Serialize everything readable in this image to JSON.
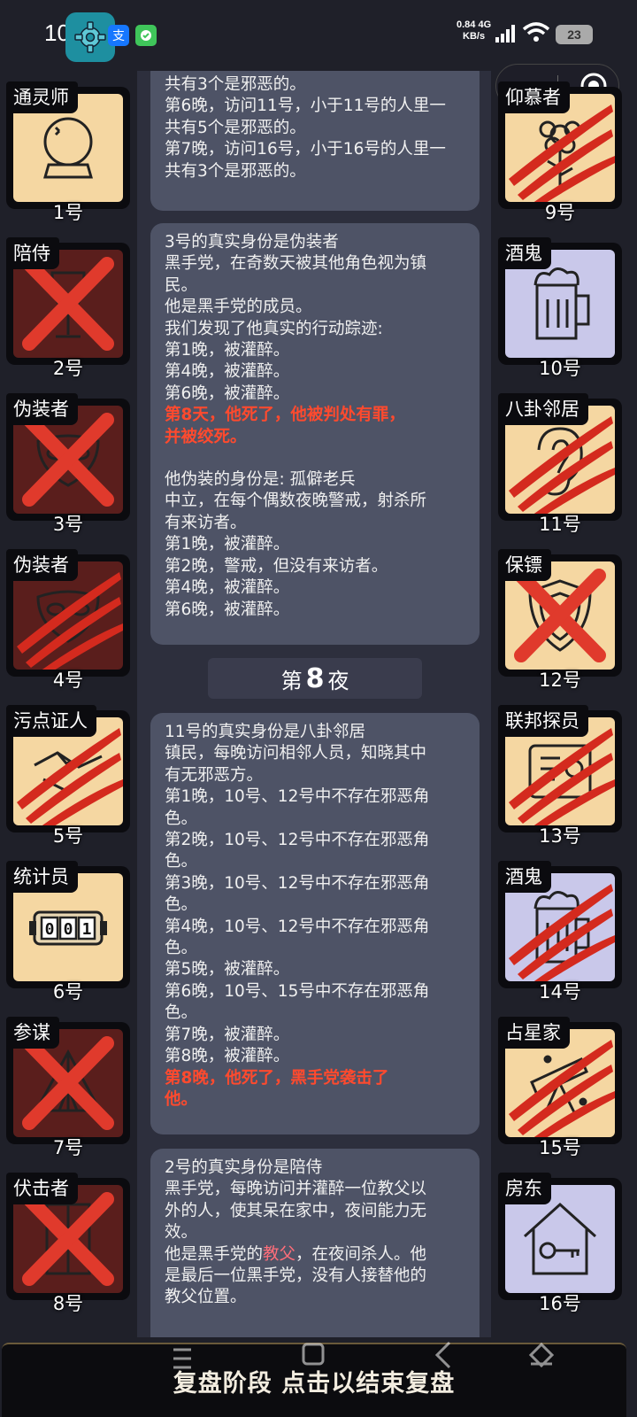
{
  "status_bar": {
    "time": "10:25",
    "alipay_badge": "支",
    "network_speed_value": "0.84",
    "network_speed_unit": "KB/s",
    "network_type": "4G",
    "battery": "23",
    "icons": [
      "gear-icon",
      "alipay-icon",
      "chat-icon",
      "signal-icon",
      "wifi-icon",
      "battery-icon"
    ]
  },
  "colors": {
    "background": "#1f2029",
    "bubble": "#4e5366",
    "highlight_red": "#ff4a2e",
    "highlight_pink": "#ff6e7a",
    "card_cream": "#f5d7a2",
    "card_lavender": "#c9c8ea",
    "card_dead": "#5a1e1c",
    "slash_red": "#d42a1e"
  },
  "left_cards": [
    {
      "role": "通灵师",
      "number": "1号",
      "bg": "cream",
      "state": "alive",
      "icon": "crystal-ball-icon"
    },
    {
      "role": "陪侍",
      "number": "2号",
      "bg": "dark",
      "state": "executed",
      "icon": "wine-glass-icon"
    },
    {
      "role": "伪装者",
      "number": "3号",
      "bg": "dark",
      "state": "executed",
      "icon": "mask-icon"
    },
    {
      "role": "伪装者",
      "number": "4号",
      "bg": "dark",
      "state": "killed",
      "icon": "mask-icon"
    },
    {
      "role": "污点证人",
      "number": "5号",
      "bg": "cream",
      "state": "killed",
      "icon": "handshake-icon"
    },
    {
      "role": "统计员",
      "number": "6号",
      "bg": "cream",
      "state": "alive",
      "icon": "counter-icon",
      "counter": "001"
    },
    {
      "role": "参谋",
      "number": "7号",
      "bg": "dark",
      "state": "executed",
      "icon": "tent-icon"
    },
    {
      "role": "伏击者",
      "number": "8号",
      "bg": "dark",
      "state": "executed",
      "icon": "door-icon"
    }
  ],
  "right_cards": [
    {
      "role": "仰慕者",
      "number": "9号",
      "bg": "cream",
      "state": "killed",
      "icon": "flower-icon"
    },
    {
      "role": "酒鬼",
      "number": "10号",
      "bg": "lav",
      "state": "alive",
      "icon": "beer-mug-icon"
    },
    {
      "role": "八卦邻居",
      "number": "11号",
      "bg": "cream",
      "state": "killed",
      "icon": "ear-icon"
    },
    {
      "role": "保镖",
      "number": "12号",
      "bg": "cream",
      "state": "executed",
      "icon": "shield-icon"
    },
    {
      "role": "联邦探员",
      "number": "13号",
      "bg": "cream",
      "state": "killed",
      "icon": "badge-icon"
    },
    {
      "role": "酒鬼",
      "number": "14号",
      "bg": "lav",
      "state": "killed",
      "icon": "beer-mug-icon"
    },
    {
      "role": "占星家",
      "number": "15号",
      "bg": "cream",
      "state": "killed",
      "icon": "telescope-icon"
    },
    {
      "role": "房东",
      "number": "16号",
      "bg": "lav",
      "state": "alive",
      "icon": "house-key-icon"
    }
  ],
  "log": {
    "bubble1": [
      {
        "text": "共有3个是邪恶的。",
        "style": ""
      },
      {
        "text": "第6晚，访问11号，小于11号的人里一",
        "style": ""
      },
      {
        "text": "共有5个是邪恶的。",
        "style": ""
      },
      {
        "text": "第7晚，访问16号，小于16号的人里一",
        "style": ""
      },
      {
        "text": "共有3个是邪恶的。",
        "style": ""
      }
    ],
    "bubble2": [
      {
        "text": "3号的真实身份是伪装者",
        "style": ""
      },
      {
        "text": "黑手党，在奇数天被其他角色视为镇",
        "style": ""
      },
      {
        "text": "民。",
        "style": ""
      },
      {
        "text": "他是黑手党的成员。",
        "style": ""
      },
      {
        "text": "我们发现了他真实的行动踪迹:",
        "style": ""
      },
      {
        "text": "第1晚，被灌醉。",
        "style": ""
      },
      {
        "text": "第4晚，被灌醉。",
        "style": ""
      },
      {
        "text": "第6晚，被灌醉。",
        "style": ""
      },
      {
        "text": "第8天，他死了，他被判处有罪，",
        "style": "red"
      },
      {
        "text": "并被绞死。",
        "style": "red"
      },
      {
        "text": " ",
        "style": ""
      },
      {
        "text": "他伪装的身份是: 孤僻老兵",
        "style": ""
      },
      {
        "text": "中立，在每个偶数夜晚警戒，射杀所",
        "style": ""
      },
      {
        "text": "有来访者。",
        "style": ""
      },
      {
        "text": "第1晚，被灌醉。",
        "style": ""
      },
      {
        "text": "第2晚，警戒，但没有来访者。",
        "style": ""
      },
      {
        "text": "第4晚，被灌醉。",
        "style": ""
      },
      {
        "text": "第6晚，被灌醉。",
        "style": ""
      }
    ],
    "night_divider": {
      "prefix": "第",
      "number": "8",
      "suffix": "夜"
    },
    "bubble3": [
      {
        "text": "11号的真实身份是八卦邻居",
        "style": ""
      },
      {
        "text": "镇民，每晚访问相邻人员，知晓其中",
        "style": ""
      },
      {
        "text": "有无邪恶方。",
        "style": ""
      },
      {
        "text": "第1晚，10号、12号中不存在邪恶角",
        "style": ""
      },
      {
        "text": "色。",
        "style": ""
      },
      {
        "text": "第2晚，10号、12号中不存在邪恶角",
        "style": ""
      },
      {
        "text": "色。",
        "style": ""
      },
      {
        "text": "第3晚，10号、12号中不存在邪恶角",
        "style": ""
      },
      {
        "text": "色。",
        "style": ""
      },
      {
        "text": "第4晚，10号、12号中不存在邪恶角",
        "style": ""
      },
      {
        "text": "色。",
        "style": ""
      },
      {
        "text": "第5晚，被灌醉。",
        "style": ""
      },
      {
        "text": "第6晚，10号、15号中不存在邪恶角",
        "style": ""
      },
      {
        "text": "色。",
        "style": ""
      },
      {
        "text": "第7晚，被灌醉。",
        "style": ""
      },
      {
        "text": "第8晚，被灌醉。",
        "style": ""
      },
      {
        "text": "第8晚，他死了，黑手党袭击了",
        "style": "red"
      },
      {
        "text": "他。",
        "style": "red"
      }
    ],
    "bubble4": [
      {
        "text": "2号的真实身份是陪侍",
        "style": ""
      },
      {
        "text": "黑手党，每晚访问并灌醉一位教父以",
        "style": ""
      },
      {
        "text": "外的人，使其呆在家中，夜间能力无",
        "style": ""
      },
      {
        "text": "效。",
        "style": ""
      },
      {
        "segments": [
          {
            "text": "他是黑手党的",
            "style": ""
          },
          {
            "text": "教父",
            "style": "pink"
          },
          {
            "text": "，在夜间杀人。他",
            "style": ""
          }
        ]
      },
      {
        "text": "是最后一位黑手党，没有人接替他的",
        "style": ""
      },
      {
        "text": "教父位置。",
        "style": ""
      }
    ]
  },
  "bottom_bar": {
    "label": "复盘阶段 点击以结束复盘"
  }
}
